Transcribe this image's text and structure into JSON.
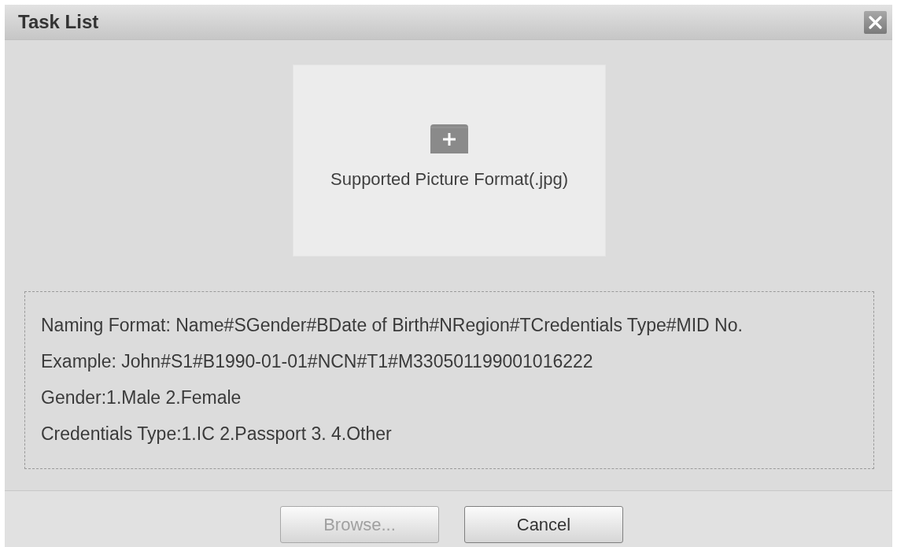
{
  "dialog": {
    "title": "Task List"
  },
  "upload": {
    "hint": "Supported Picture Format(.jpg)"
  },
  "instructions": [
    "Naming Format: Name#SGender#BDate of Birth#NRegion#TCredentials Type#MID No.",
    "Example: John#S1#B1990-01-01#NCN#T1#M330501199001016222",
    "Gender:1.Male 2.Female",
    "Credentials Type:1.IC 2.Passport 3. 4.Other"
  ],
  "buttons": [
    {
      "label": "Browse...",
      "disabled": true
    },
    {
      "label": "Cancel",
      "disabled": false
    }
  ]
}
